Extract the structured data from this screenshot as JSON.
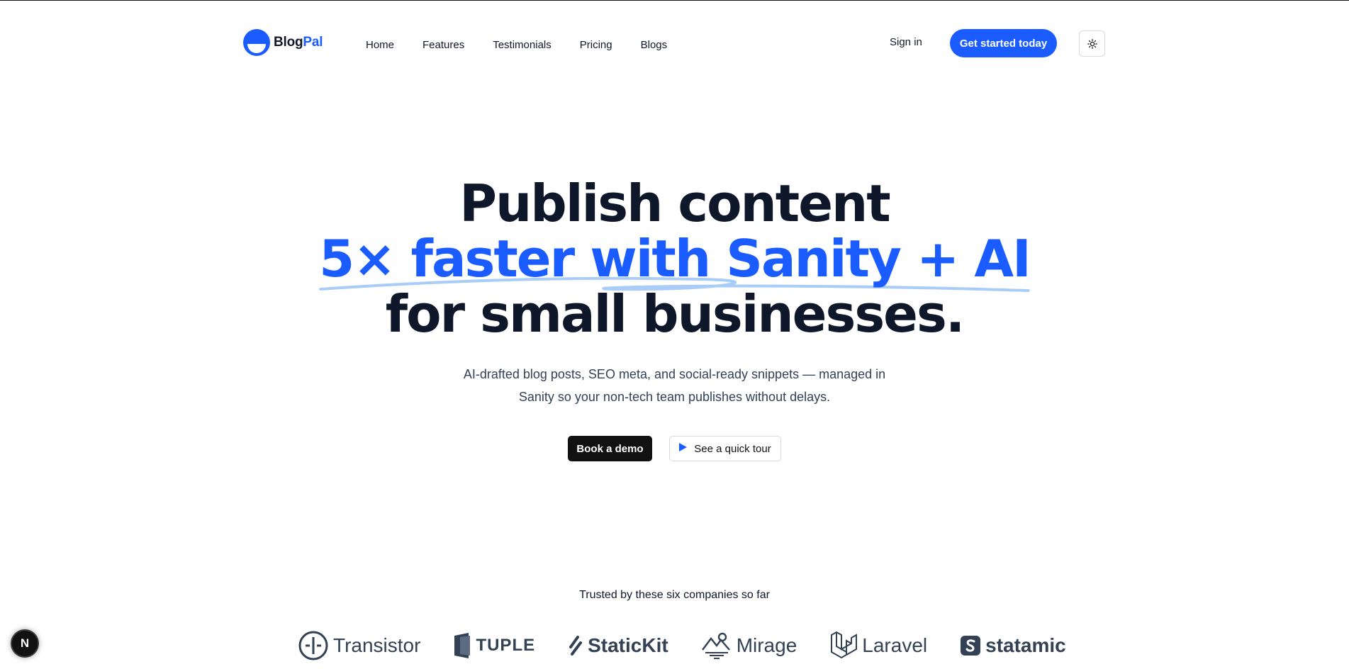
{
  "brand": {
    "name_part1": "Blog",
    "name_part2": "Pal",
    "color": "#1a5cff"
  },
  "nav": {
    "items": [
      "Home",
      "Features",
      "Testimonials",
      "Pricing",
      "Blogs"
    ]
  },
  "header": {
    "signin": "Sign in",
    "cta": "Get started today",
    "theme_icon": "sun-icon"
  },
  "hero": {
    "line1": "Publish content",
    "line2": "5× faster with Sanity + AI",
    "line3": "for small businesses.",
    "sub1": "AI-drafted blog posts, SEO meta, and social-ready snippets — managed in",
    "sub2": "Sanity so your non-tech team publishes without delays.",
    "primary_btn": "Book a demo",
    "secondary_btn": "See a quick tour"
  },
  "trusted": {
    "heading": "Trusted by these six companies so far",
    "companies": [
      "Transistor",
      "TUPLE",
      "StaticKit",
      "Mirage",
      "Laravel",
      "statamic"
    ]
  },
  "dev_badge": "N"
}
